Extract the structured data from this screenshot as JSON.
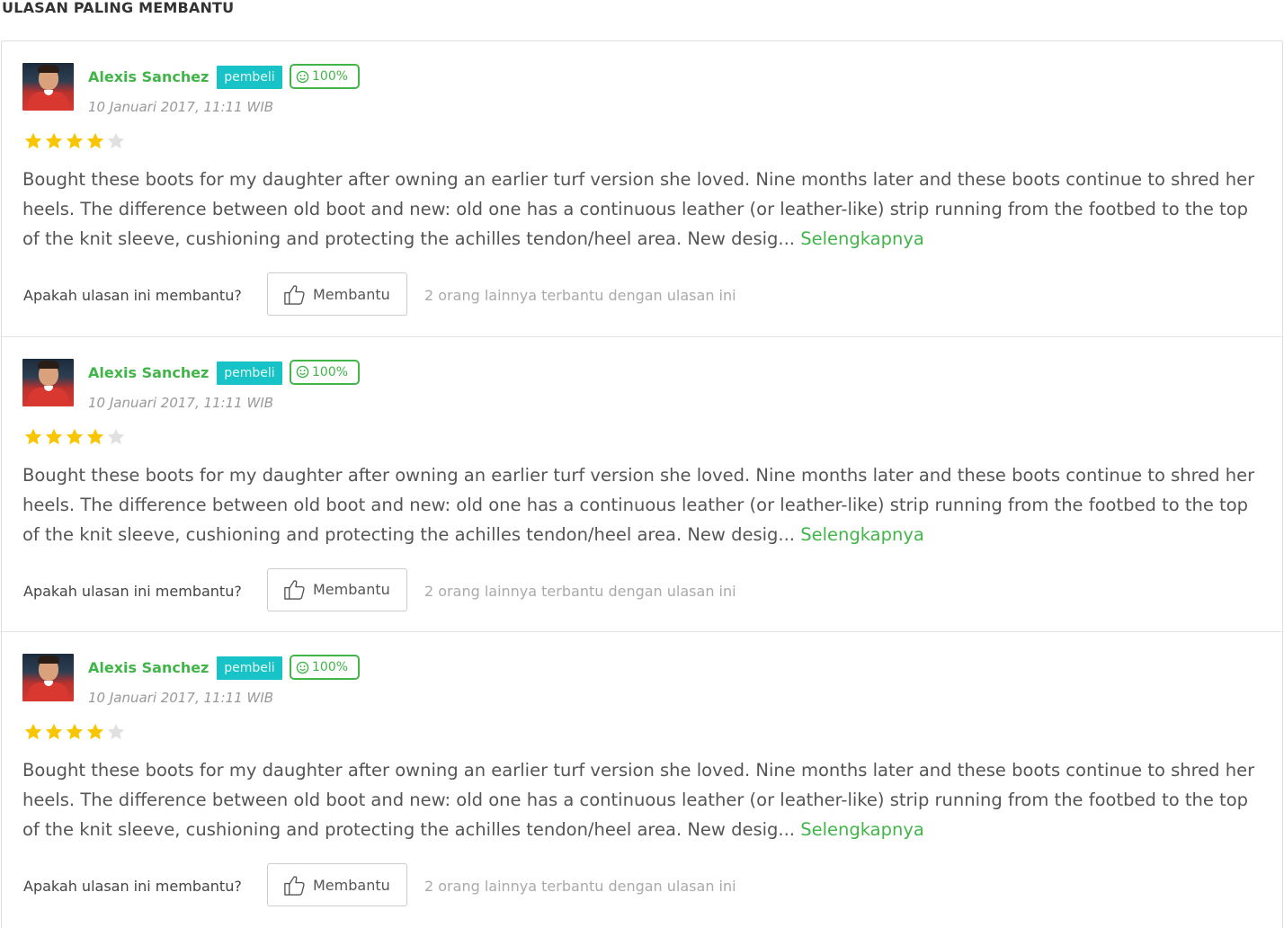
{
  "section": {
    "title": "ULASAN PALING MEMBANTU"
  },
  "colors": {
    "accent": "#42b549",
    "buyer_badge": "#17c3c6",
    "star_filled": "#f8c600",
    "star_empty": "#e0e0e0"
  },
  "reviews": [
    {
      "reviewer": "Alexis Sanchez",
      "badge": "pembeli",
      "reputation": "100%",
      "reputation_icon": "smiley-icon",
      "date": "10 Januari 2017, 11:11 WIB",
      "rating": 4,
      "rating_max": 5,
      "text": "Bought these boots for my daughter after owning an earlier turf version she loved. Nine months later and these boots continue to shred her heels. The difference between old boot and new: old one has a continuous leather (or leather-like) strip running from the footbed to the top of the knit sleeve, cushioning and protecting the achilles tendon/heel area. New desig... ",
      "read_more": "Selengkapnya",
      "helpful_question": "Apakah ulasan ini membantu?",
      "helpful_button": "Membantu",
      "helpful_count": "2 orang lainnya terbantu dengan ulasan ini"
    },
    {
      "reviewer": "Alexis Sanchez",
      "badge": "pembeli",
      "reputation": "100%",
      "reputation_icon": "smiley-icon",
      "date": "10 Januari 2017, 11:11 WIB",
      "rating": 4,
      "rating_max": 5,
      "text": "Bought these boots for my daughter after owning an earlier turf version she loved. Nine months later and these boots continue to shred her heels. The difference between old boot and new: old one has a continuous leather (or leather-like) strip running from the footbed to the top of the knit sleeve, cushioning and protecting the achilles tendon/heel area. New desig... ",
      "read_more": "Selengkapnya",
      "helpful_question": "Apakah ulasan ini membantu?",
      "helpful_button": "Membantu",
      "helpful_count": "2 orang lainnya terbantu dengan ulasan ini"
    },
    {
      "reviewer": "Alexis Sanchez",
      "badge": "pembeli",
      "reputation": "100%",
      "reputation_icon": "smiley-icon",
      "date": "10 Januari 2017, 11:11 WIB",
      "rating": 4,
      "rating_max": 5,
      "text": "Bought these boots for my daughter after owning an earlier turf version she loved. Nine months later and these boots continue to shred her heels. The difference between old boot and new: old one has a continuous leather (or leather-like) strip running from the footbed to the top of the knit sleeve, cushioning and protecting the achilles tendon/heel area. New desig... ",
      "read_more": "Selengkapnya",
      "helpful_question": "Apakah ulasan ini membantu?",
      "helpful_button": "Membantu",
      "helpful_count": "2 orang lainnya terbantu dengan ulasan ini"
    }
  ]
}
